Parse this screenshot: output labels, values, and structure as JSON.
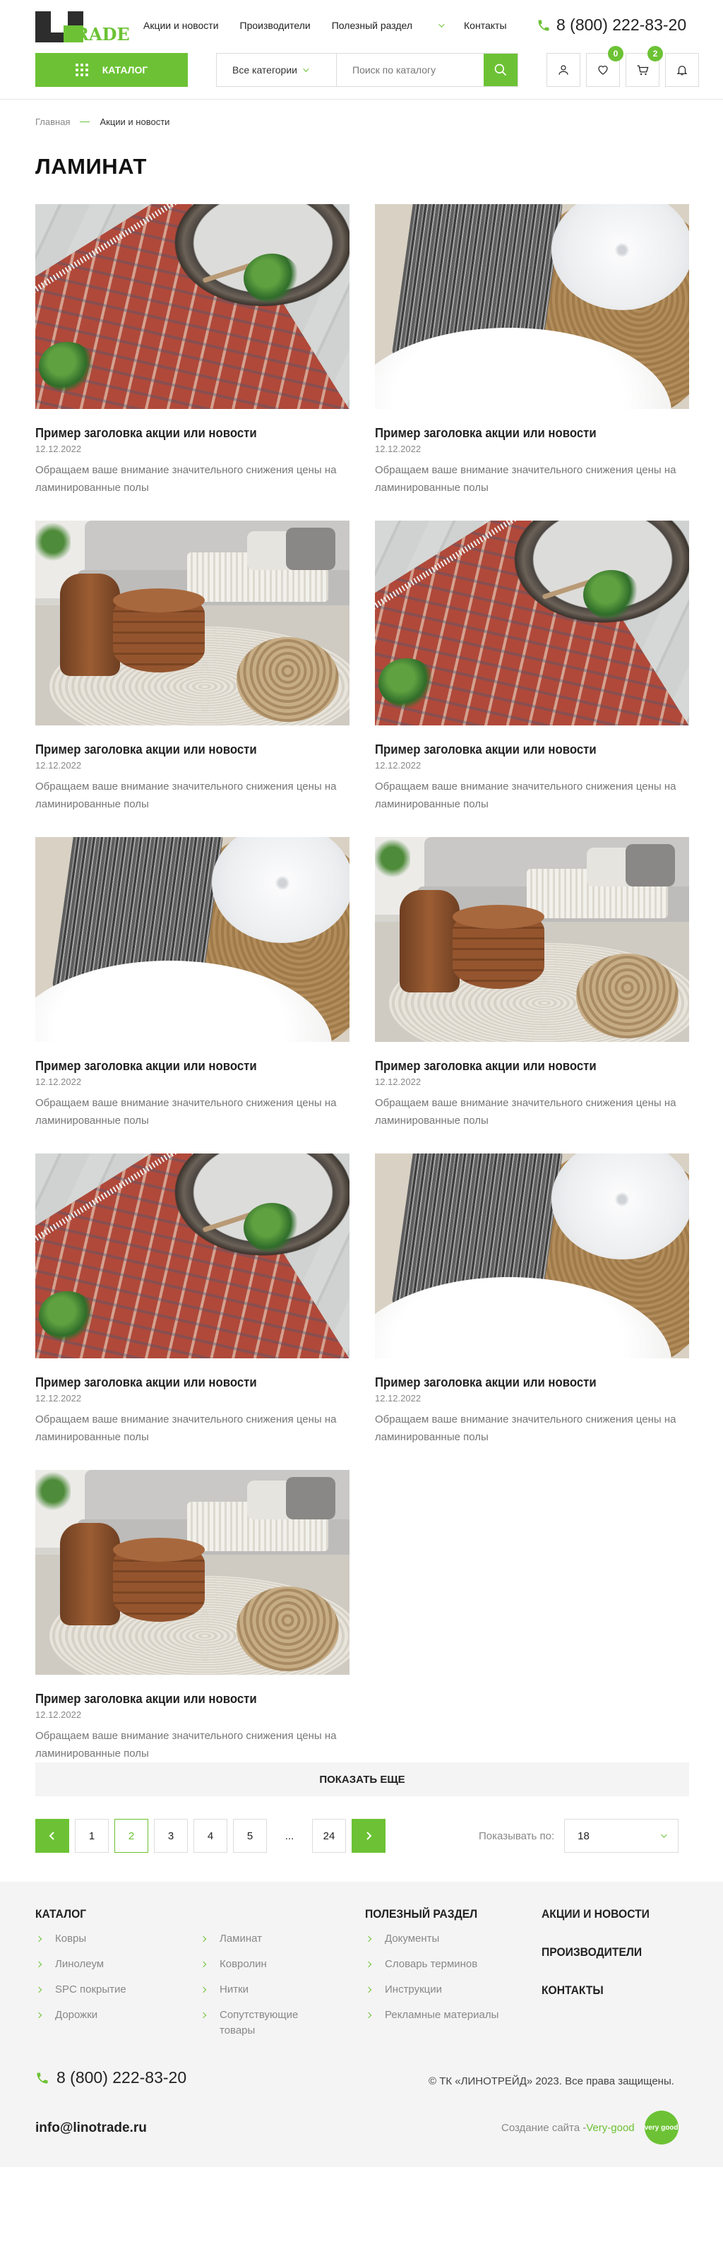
{
  "header": {
    "logo_text": "RADE",
    "nav": [
      {
        "label": "Акции и новости"
      },
      {
        "label": "Производители"
      },
      {
        "label": "Полезный раздел"
      },
      {
        "label": "Контакты"
      }
    ],
    "phone": "8 (800) 222-83-20",
    "catalog_label": "Каталог",
    "category_select": "Все категории",
    "search_placeholder": "Поиск по каталогу",
    "favorites_count": "0",
    "cart_count": "2",
    "accent_color": "#6cc234"
  },
  "breadcrumb": {
    "home": "Главная",
    "current": "Акции и новости"
  },
  "page_title": "ЛАМИНАТ",
  "cards": [
    {
      "title": "Пример заголовка акции или новости",
      "date": "12.12.2022",
      "desc": "Обращаем ваше внимание значительного снижения цены на ламинированные полы",
      "image": "rug-mirror"
    },
    {
      "title": "Пример заголовка акции или новости",
      "date": "12.12.2022",
      "desc": "Обращаем ваше внимание значительного снижения цены на ламинированные полы",
      "image": "pillows-fur"
    },
    {
      "title": "Пример заголовка акции или новости",
      "date": "12.12.2022",
      "desc": "Обращаем ваше внимание значительного снижения цены на ламинированные полы",
      "image": "sofa-room"
    },
    {
      "title": "Пример заголовка акции или новости",
      "date": "12.12.2022",
      "desc": "Обращаем ваше внимание значительного снижения цены на ламинированные полы",
      "image": "rug-mirror"
    },
    {
      "title": "Пример заголовка акции или новости",
      "date": "12.12.2022",
      "desc": "Обращаем ваше внимание значительного снижения цены на ламинированные полы",
      "image": "pillows-fur"
    },
    {
      "title": "Пример заголовка акции или новости",
      "date": "12.12.2022",
      "desc": "Обращаем ваше внимание значительного снижения цены на ламинированные полы",
      "image": "sofa-room"
    },
    {
      "title": "Пример заголовка акции или новости",
      "date": "12.12.2022",
      "desc": "Обращаем ваше внимание значительного снижения цены на ламинированные полы",
      "image": "rug-mirror"
    },
    {
      "title": "Пример заголовка акции или новости",
      "date": "12.12.2022",
      "desc": "Обращаем ваше внимание значительного снижения цены на ламинированные полы",
      "image": "pillows-fur"
    },
    {
      "title": "Пример заголовка акции или новости",
      "date": "12.12.2022",
      "desc": "Обращаем ваше внимание значительного снижения цены на ламинированные полы",
      "image": "sofa-room"
    }
  ],
  "show_more": "Показать еще",
  "pagination": {
    "pages": [
      "1",
      "2",
      "3",
      "4",
      "5",
      "...",
      "24"
    ],
    "active": "2"
  },
  "show_by": {
    "label": "Показывать по:",
    "value": "18"
  },
  "footer": {
    "catalog_head": "Каталог",
    "catalog_col1": [
      "Ковры",
      "Линолеум",
      "SPC покрытие",
      "Дорожки"
    ],
    "catalog_col2": [
      "Ламинат",
      "Ковролин",
      "Нитки",
      "Сопутствующие товары"
    ],
    "useful_head": "Полезный раздел",
    "useful": [
      "Документы",
      "Словарь терминов",
      "Инструкции",
      "Рекламные материалы"
    ],
    "links": [
      "Акции и новости",
      "Производители",
      "Контакты"
    ],
    "phone": "8 (800) 222-83-20",
    "email": "info@linotrade.ru",
    "copyright": "© ТК «ЛИНОТРЕЙД» 2023. Все права защищены.",
    "dev_prefix": "Создание сайта -",
    "dev_link": "Very-good",
    "dev_badge": "very good"
  }
}
